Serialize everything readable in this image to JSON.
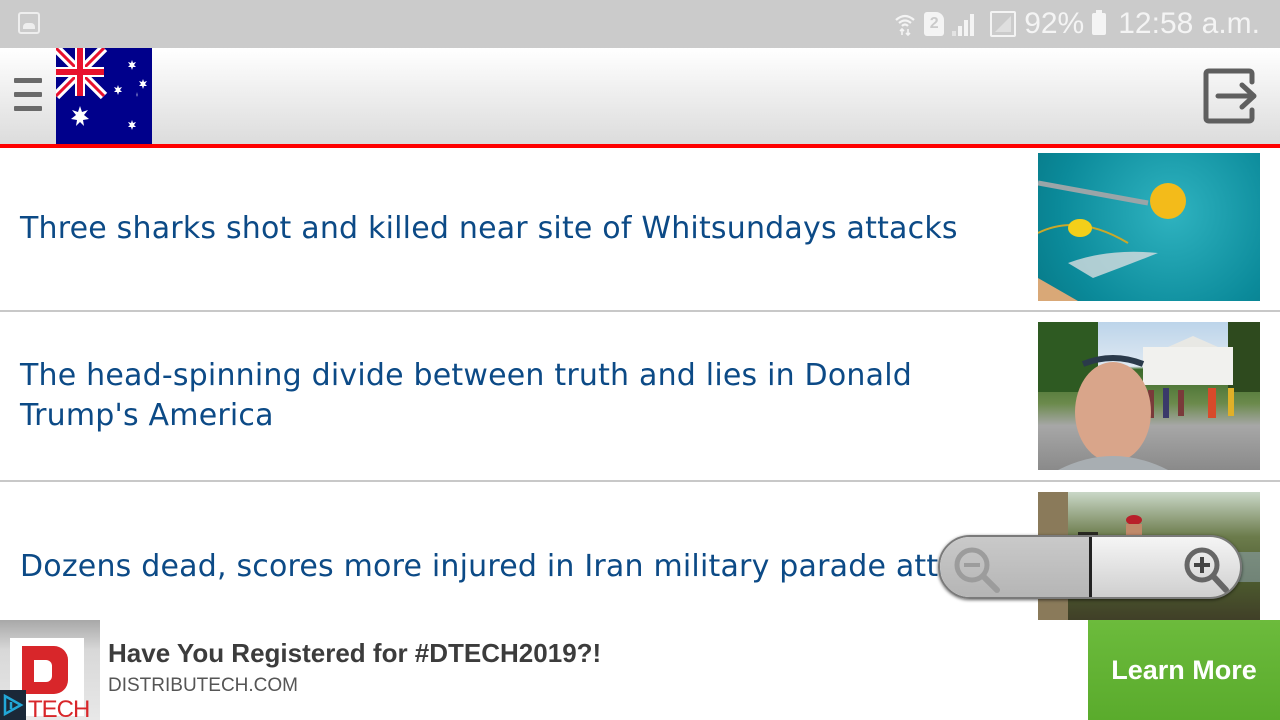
{
  "status_bar": {
    "battery_percent": "92%",
    "time": "12:58 a.m.",
    "sim_slot": "2",
    "icons": [
      "gallery-icon",
      "wifi-icon",
      "sim-icon",
      "signal-icon",
      "signal-secondary-icon",
      "battery-icon"
    ]
  },
  "header": {
    "menu_icon": "hamburger-icon",
    "flag": "australia-flag",
    "logout_icon": "logout-icon",
    "accent_color": "#ff0000"
  },
  "news": {
    "headline_color": "#0c4a86",
    "items": [
      {
        "headline": "Three sharks shot and killed near site of Whitsundays attacks",
        "image": "sharks-buoy-photo"
      },
      {
        "headline": "The head-spinning divide between truth and lies in Donald Trump's America",
        "image": "white-house-selfie-photo"
      },
      {
        "headline": "Dozens dead, scores more injured in Iran military parade attack",
        "image": "iran-parade-soldier-photo"
      }
    ]
  },
  "zoom_control": {
    "zoom_out_icon": "zoom-out-icon",
    "zoom_in_icon": "zoom-in-icon"
  },
  "ad": {
    "logo_text": "TECH",
    "title": "Have You Registered for #DTECH2019?!",
    "domain": "DISTRIBUTECH.COM",
    "cta_label": "Learn More",
    "cta_color": "#62b334"
  }
}
